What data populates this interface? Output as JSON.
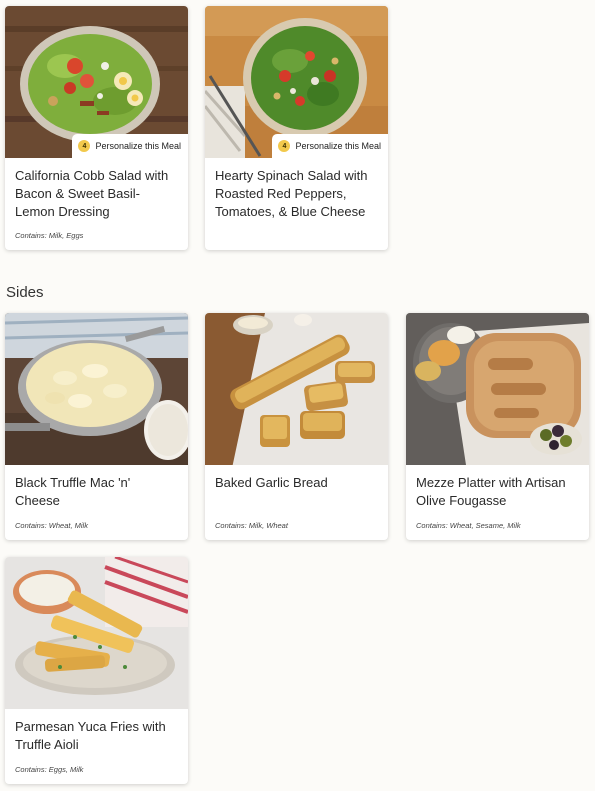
{
  "salads": [
    {
      "title": "California Cobb Salad with Bacon & Sweet Basil-Lemon Dressing",
      "contains": "Contains: Milk, Eggs",
      "personalize": {
        "count": "4",
        "label": "Personalize this Meal"
      }
    },
    {
      "title": "Hearty Spinach Salad with Roasted Red Peppers, Tomatoes, & Blue Cheese",
      "contains": "",
      "personalize": {
        "count": "4",
        "label": "Personalize this Meal"
      }
    }
  ],
  "sides_section": {
    "title": "Sides"
  },
  "sides": [
    {
      "title": "Black Truffle Mac 'n' Cheese",
      "contains": "Contains: Wheat, Milk"
    },
    {
      "title": "Baked Garlic Bread",
      "contains": "Contains: Milk, Wheat"
    },
    {
      "title": "Mezze Platter with Artisan Olive Fougasse",
      "contains": "Contains: Wheat, Sesame, Milk"
    },
    {
      "title": "Parmesan Yuca Fries with Truffle Aioli",
      "contains": "Contains: Eggs, Milk"
    }
  ],
  "colors": {
    "badge": "#f2c94c",
    "background": "#fcfbf8",
    "card": "#ffffff"
  }
}
